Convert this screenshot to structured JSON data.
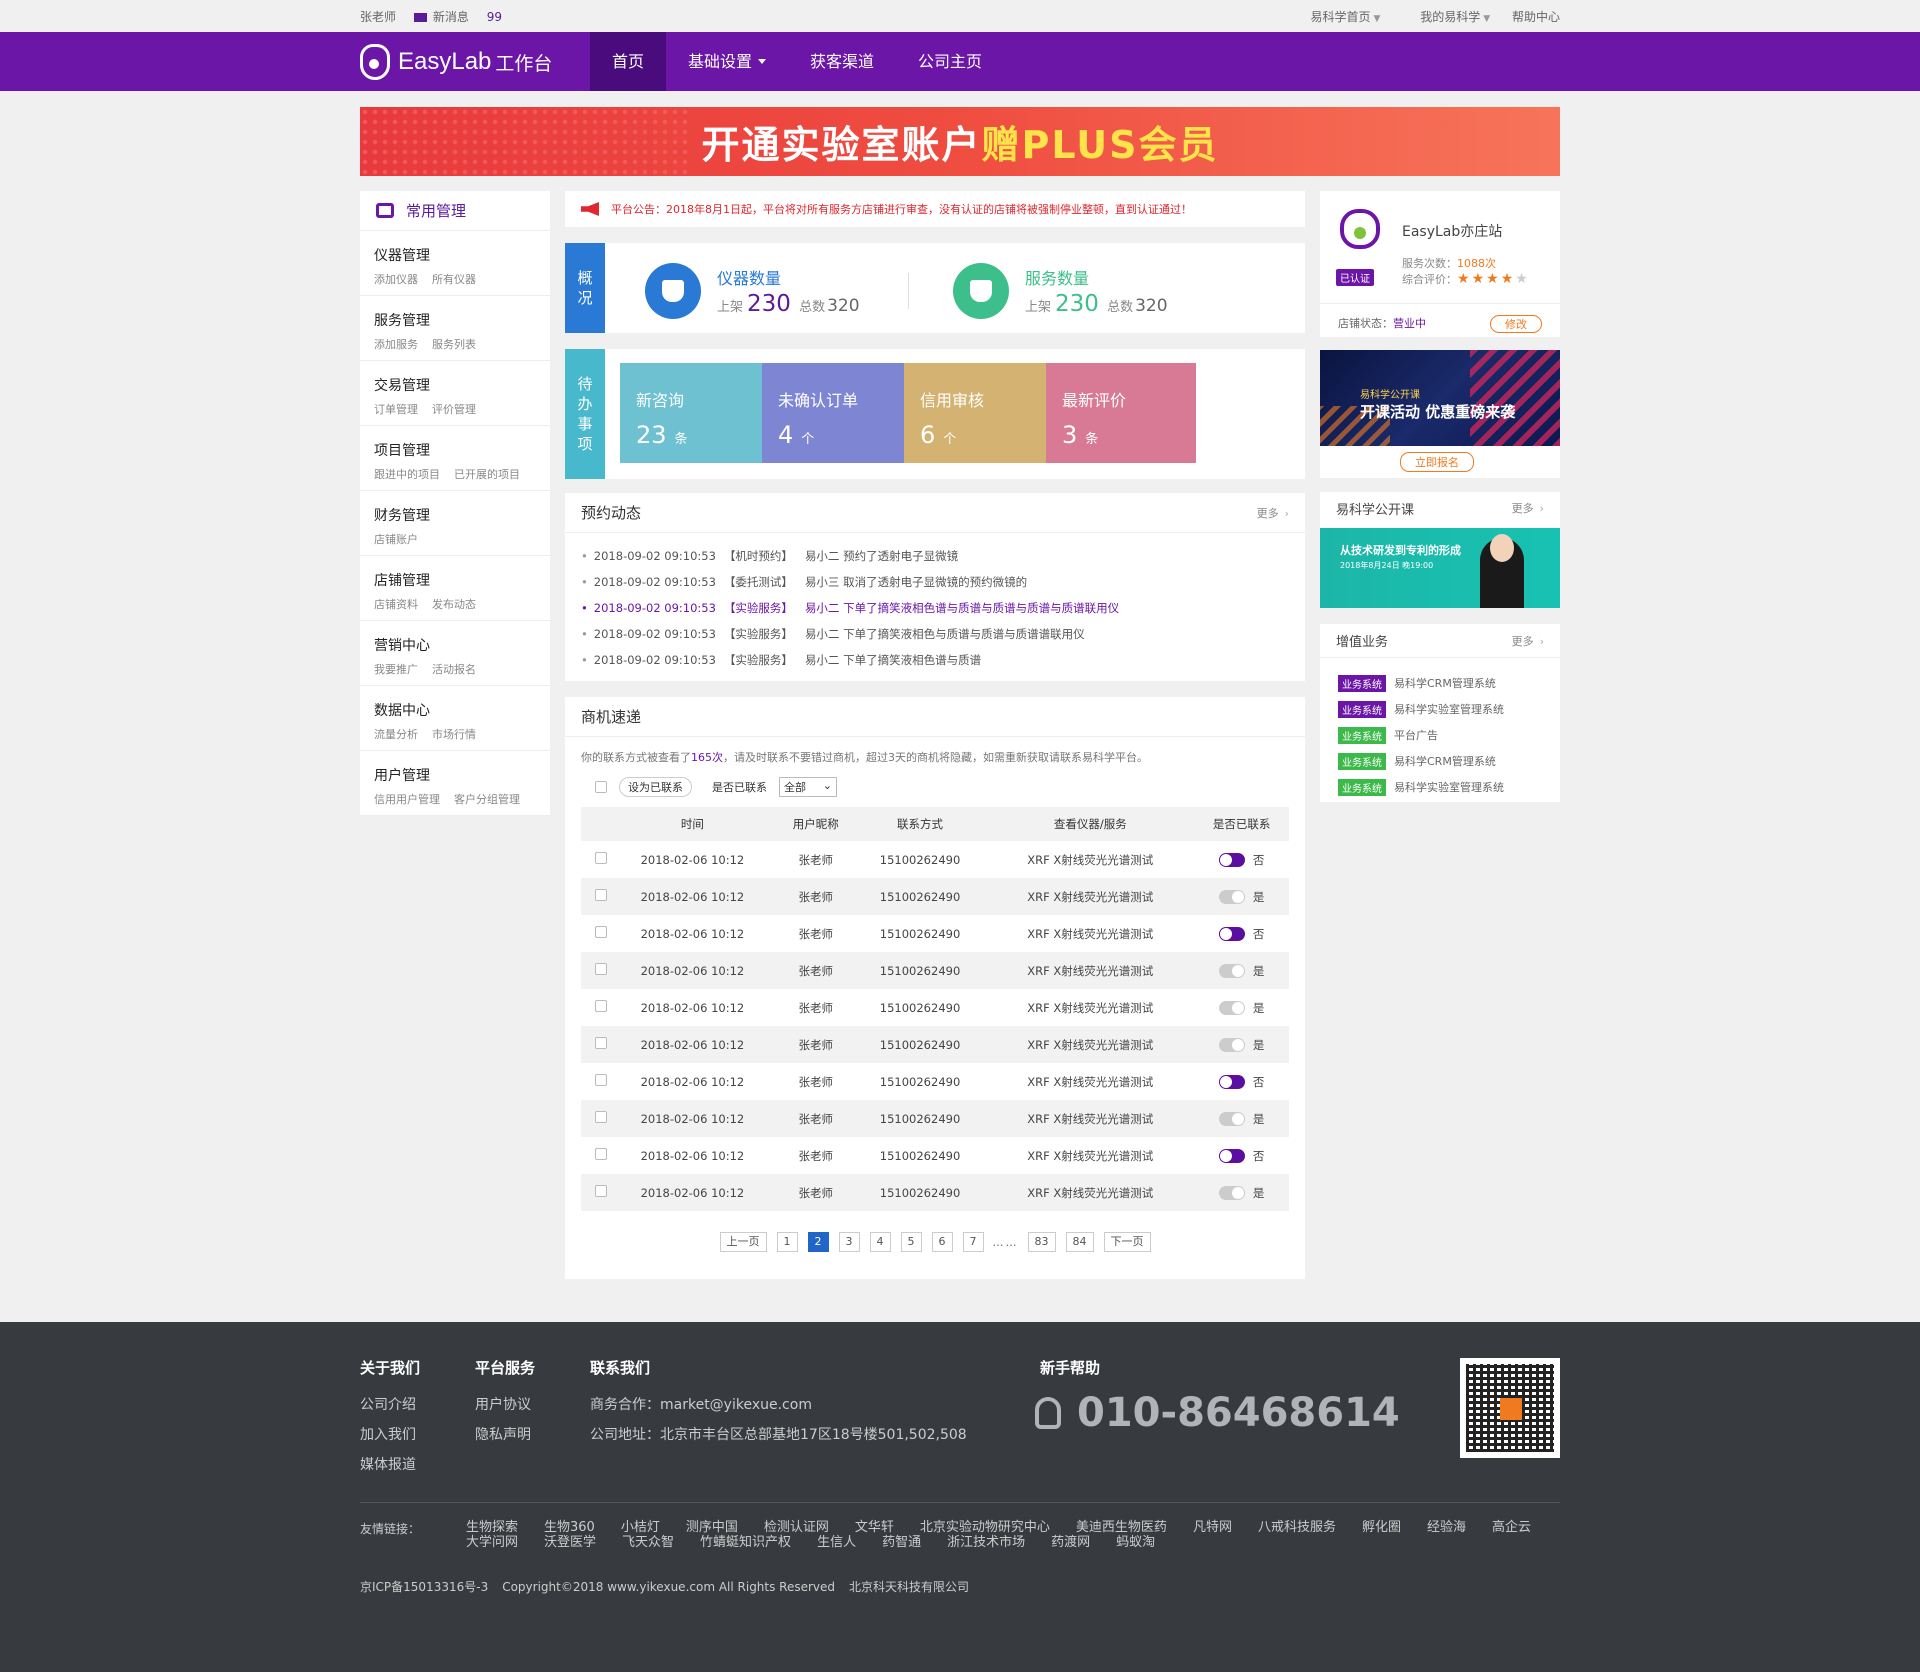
{
  "topbar": {
    "user": "张老师",
    "msg_label": "新消息",
    "msg_count": "99",
    "links": [
      "易科学首页",
      "我的易科学",
      "帮助中心"
    ]
  },
  "nav": {
    "logo_text": "EasyLab",
    "logo_sub": "工作台",
    "items": [
      "首页",
      "基础设置",
      "获客渠道",
      "公司主页"
    ],
    "active": "首页"
  },
  "banner": {
    "text1": "开通实验室账户",
    "text2": "赠PLUS会员"
  },
  "sidebar": {
    "title": "常用管理",
    "groups": [
      {
        "title": "仪器管理",
        "subs": [
          "添加仪器",
          "所有仪器"
        ]
      },
      {
        "title": "服务管理",
        "subs": [
          "添加服务",
          "服务列表"
        ]
      },
      {
        "title": "交易管理",
        "subs": [
          "订单管理",
          "评价管理"
        ]
      },
      {
        "title": "项目管理",
        "subs": [
          "跟进中的项目",
          "已开展的项目"
        ]
      },
      {
        "title": "财务管理",
        "subs": [
          "店铺账户"
        ]
      },
      {
        "title": "店铺管理",
        "subs": [
          "店铺资料",
          "发布动态"
        ]
      },
      {
        "title": "营销中心",
        "subs": [
          "我要推广",
          "活动报名"
        ]
      },
      {
        "title": "数据中心",
        "subs": [
          "流量分析",
          "市场行情"
        ]
      },
      {
        "title": "用户管理",
        "subs": [
          "信用用户管理",
          "客户分组管理"
        ]
      }
    ]
  },
  "notice": "平台公告：2018年8月1日起，平台将对所有服务方店铺进行审查，没有认证的店铺将被强制停业整顿，直到认证通过！",
  "overview": {
    "label": "概况",
    "instrument": {
      "name": "仪器数量",
      "on_label": "上架",
      "on": "230",
      "total_label": "总数",
      "total": "320"
    },
    "service": {
      "name": "服务数量",
      "on_label": "上架",
      "on": "230",
      "total_label": "总数",
      "total": "320"
    }
  },
  "todo": {
    "label": "待办事项",
    "cards": [
      {
        "name": "新咨询",
        "count": "23",
        "unit": "条",
        "color": "#6ec1d0"
      },
      {
        "name": "未确认订单",
        "count": "4",
        "unit": "个",
        "color": "#7e86d4"
      },
      {
        "name": "信用审核",
        "count": "6",
        "unit": "个",
        "color": "#d4b272"
      },
      {
        "name": "最新评价",
        "count": "3",
        "unit": "条",
        "color": "#d87a96"
      }
    ]
  },
  "booking": {
    "title": "预约动态",
    "more": "更多",
    "items": [
      {
        "time": "2018-09-02 09:10:53",
        "type": "【机时预约】",
        "text": "易小二 预约了透射电子显微镜"
      },
      {
        "time": "2018-09-02 09:10:53",
        "type": "【委托测试】",
        "text": "易小三 取消了透射电子显微镜的预约微镜的"
      },
      {
        "time": "2018-09-02 09:10:53",
        "type": "【实验服务】",
        "text": "易小二 下单了摘笑液相色谱与质谱与质谱与质谱与质谱联用仪"
      },
      {
        "time": "2018-09-02 09:10:53",
        "type": "【实验服务】",
        "text": "易小二 下单了摘笑液相色与质谱与质谱与质谱谱联用仪"
      },
      {
        "time": "2018-09-02 09:10:53",
        "type": "【实验服务】",
        "text": "易小二 下单了摘笑液相色谱与质谱"
      }
    ]
  },
  "leads": {
    "title": "商机速递",
    "tip_pre": "你的联系方式被查看了",
    "tip_count": "165次",
    "tip_post": "，请及时联系不要错过商机，超过3天的商机将隐藏，如需重新获取请联系易科学平台。",
    "mark_btn": "设为已联系",
    "filter_label": "是否已联系",
    "filter_value": "全部",
    "columns": [
      "时间",
      "用户昵称",
      "联系方式",
      "查看仪器/服务",
      "是否已联系"
    ],
    "rows": [
      {
        "time": "2018-02-06 10:12",
        "user": "张老师",
        "phone": "15100262490",
        "item": "XRF X射线荧光光谱测试",
        "contacted": "否"
      },
      {
        "time": "2018-02-06 10:12",
        "user": "张老师",
        "phone": "15100262490",
        "item": "XRF X射线荧光光谱测试",
        "contacted": "是"
      },
      {
        "time": "2018-02-06 10:12",
        "user": "张老师",
        "phone": "15100262490",
        "item": "XRF X射线荧光光谱测试",
        "contacted": "否"
      },
      {
        "time": "2018-02-06 10:12",
        "user": "张老师",
        "phone": "15100262490",
        "item": "XRF X射线荧光光谱测试",
        "contacted": "是"
      },
      {
        "time": "2018-02-06 10:12",
        "user": "张老师",
        "phone": "15100262490",
        "item": "XRF X射线荧光光谱测试",
        "contacted": "是"
      },
      {
        "time": "2018-02-06 10:12",
        "user": "张老师",
        "phone": "15100262490",
        "item": "XRF X射线荧光光谱测试",
        "contacted": "是"
      },
      {
        "time": "2018-02-06 10:12",
        "user": "张老师",
        "phone": "15100262490",
        "item": "XRF X射线荧光光谱测试",
        "contacted": "否"
      },
      {
        "time": "2018-02-06 10:12",
        "user": "张老师",
        "phone": "15100262490",
        "item": "XRF X射线荧光光谱测试",
        "contacted": "是"
      },
      {
        "time": "2018-02-06 10:12",
        "user": "张老师",
        "phone": "15100262490",
        "item": "XRF X射线荧光光谱测试",
        "contacted": "否"
      },
      {
        "time": "2018-02-06 10:12",
        "user": "张老师",
        "phone": "15100262490",
        "item": "XRF X射线荧光光谱测试",
        "contacted": "是"
      }
    ],
    "pager": {
      "prev": "上一页",
      "pages": [
        "1",
        "2",
        "3",
        "4",
        "5",
        "6",
        "7"
      ],
      "current": "2",
      "ellipsis": "……",
      "tail": [
        "83",
        "84"
      ],
      "next": "下一页"
    }
  },
  "shop": {
    "name": "EasyLab亦庄站",
    "badge": "已认证",
    "count_label": "服务次数：",
    "count": "1088次",
    "rating_label": "综合评价：",
    "rating": 4,
    "rating_max": 5,
    "status_label": "店铺状态：",
    "status": "营业中",
    "edit": "修改"
  },
  "ad": {
    "title": "开课活动 优惠重磅来袭",
    "sub": "易科学公开课",
    "button": "立即报名"
  },
  "course": {
    "title": "易科学公开课",
    "more": "更多",
    "img_title": "从技术研发到专利的形成",
    "img_sub": "2018年8月24日 晚19:00"
  },
  "vas": {
    "title": "增值业务",
    "more": "更多",
    "items": [
      {
        "tag": "业务系统",
        "text": "易科学CRM管理系统",
        "color": "#6b16a6"
      },
      {
        "tag": "业务系统",
        "text": "易科学实验室管理系统",
        "color": "#6b16a6"
      },
      {
        "tag": "业务系统",
        "text": "平台广告",
        "color": "#3db84a"
      },
      {
        "tag": "业务系统",
        "text": "易科学CRM管理系统",
        "color": "#3db84a"
      },
      {
        "tag": "业务系统",
        "text": "易科学实验室管理系统",
        "color": "#3db84a"
      }
    ]
  },
  "footer": {
    "cols": [
      {
        "title": "关于我们",
        "items": [
          "公司介绍",
          "加入我们",
          "媒体报道"
        ]
      },
      {
        "title": "平台服务",
        "items": [
          "用户协议",
          "隐私声明"
        ]
      },
      {
        "title": "联系我们",
        "items": [
          "商务合作：market@yikexue.com",
          "公司地址：北京市丰台区总部基地17区18号楼501,502,508"
        ]
      },
      {
        "title": "新手帮助",
        "items": []
      }
    ],
    "phone": "010-86468614",
    "links_label": "友情链接：",
    "links": [
      "生物探索",
      "生物360",
      "小桔灯",
      "测序中国",
      "检测认证网",
      "文华轩",
      "北京实验动物研究中心",
      "美迪西生物医药",
      "凡特网",
      "八戒科技服务",
      "孵化圈",
      "经验海",
      "高企云",
      "大学问网",
      "沃登医学",
      "飞天众智",
      "竹蜻蜓知识产权",
      "生信人",
      "药智通",
      "浙江技术市场",
      "药渡网",
      "蚂蚁淘"
    ],
    "icp": "京ICP备15013316号-3",
    "copyright": "Copyright©2018 www.yikexue.com All Rights Reserved",
    "company": "北京科天科技有限公司"
  }
}
